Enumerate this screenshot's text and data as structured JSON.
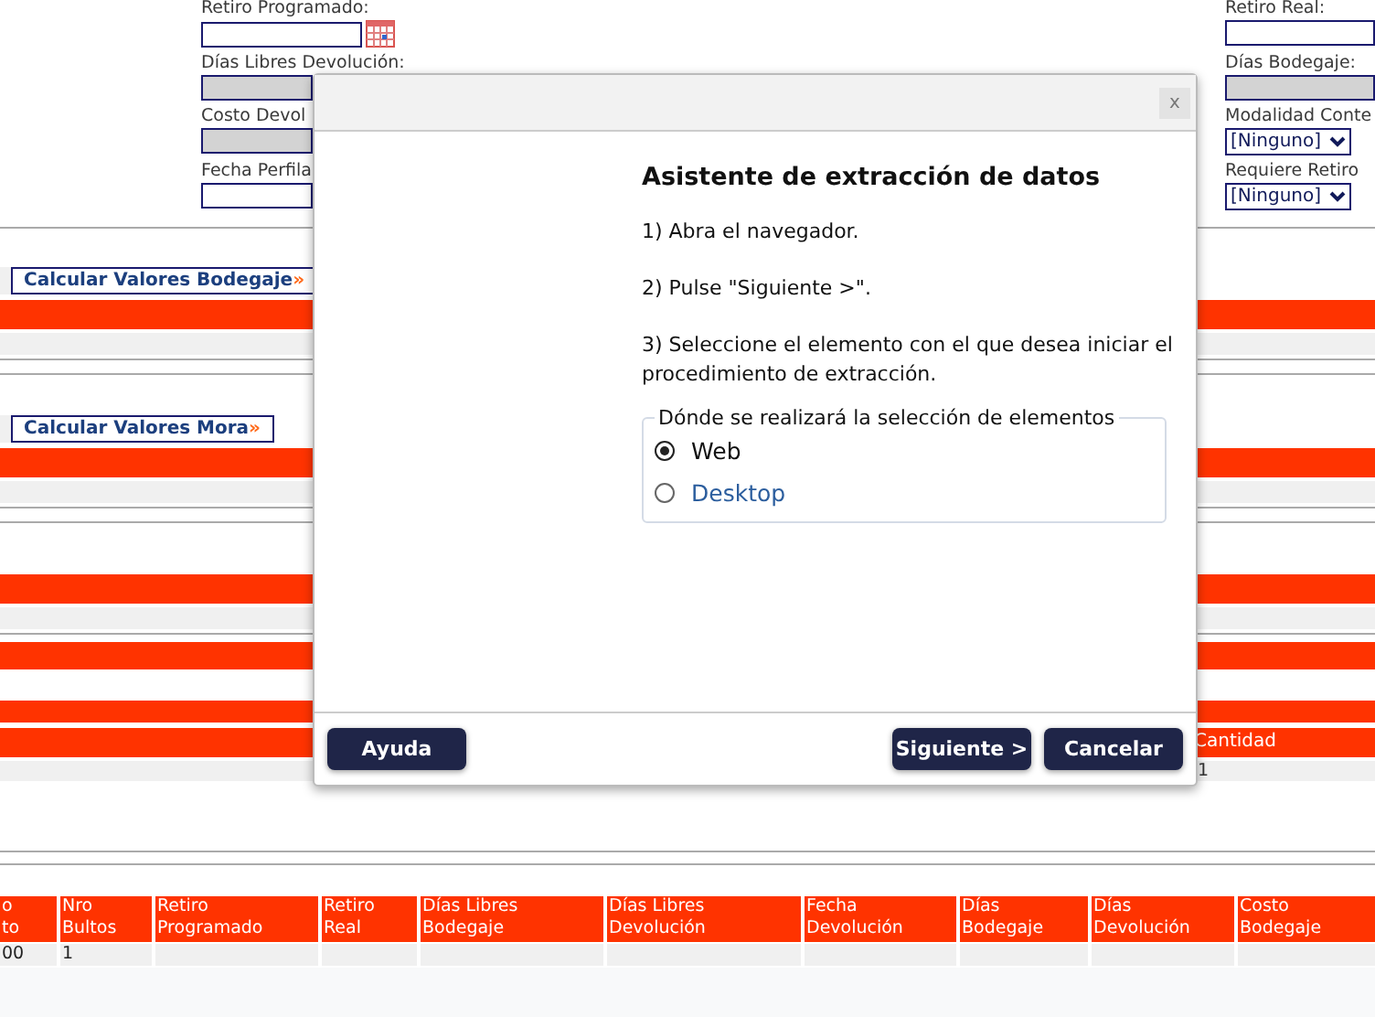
{
  "form": {
    "left": [
      {
        "label": "Retiro Programado:",
        "kind": "date"
      },
      {
        "label": "Días Libres Devolución:",
        "kind": "readonly"
      },
      {
        "label": "Costo Devol",
        "kind": "readonly"
      },
      {
        "label": "Fecha Perfila",
        "kind": "input"
      }
    ],
    "right": [
      {
        "label": "Retiro Real:",
        "kind": "input"
      },
      {
        "label": "Días Bodegaje:",
        "kind": "readonly"
      },
      {
        "label": "Modalidad Conte",
        "kind": "select",
        "value": "[Ninguno]"
      },
      {
        "label": "Requiere Retiro",
        "kind": "select",
        "value": "[Ninguno]"
      }
    ]
  },
  "actions": [
    {
      "label": "Calcular Valores Bodegaje",
      "arrow": "»"
    },
    {
      "label": "Calcular Valores Mora",
      "arrow": "»"
    }
  ],
  "quantity_table": {
    "header": "Cantidad",
    "value": "1"
  },
  "detail_table": {
    "columns": [
      "o\nto",
      "Nro\nBultos",
      "Retiro\nProgramado",
      "Retiro\nReal",
      "Días Libres\nBodegaje",
      "Días Libres\nDevolución",
      "Fecha\nDevolución",
      "Días\nBodegaje",
      "Días\nDevolución",
      "Costo\nBodegaje"
    ],
    "rows": [
      [
        "00",
        "1",
        "",
        "",
        "",
        "",
        "",
        "",
        "",
        ""
      ]
    ]
  },
  "dialog": {
    "close": "x",
    "title": "Asistente de extracción de datos",
    "steps": [
      "1) Abra el navegador.",
      "2) Pulse \"Siguiente >\".",
      "3) Seleccione el elemento con el que desea iniciar el procedimiento de extracción."
    ],
    "group_label": "Dónde se realizará la selección de elementos",
    "options": [
      {
        "label": "Web",
        "selected": true
      },
      {
        "label": "Desktop",
        "selected": false
      }
    ],
    "buttons": {
      "help": "Ayuda",
      "next": "Siguiente >",
      "cancel": "Cancelar"
    }
  }
}
